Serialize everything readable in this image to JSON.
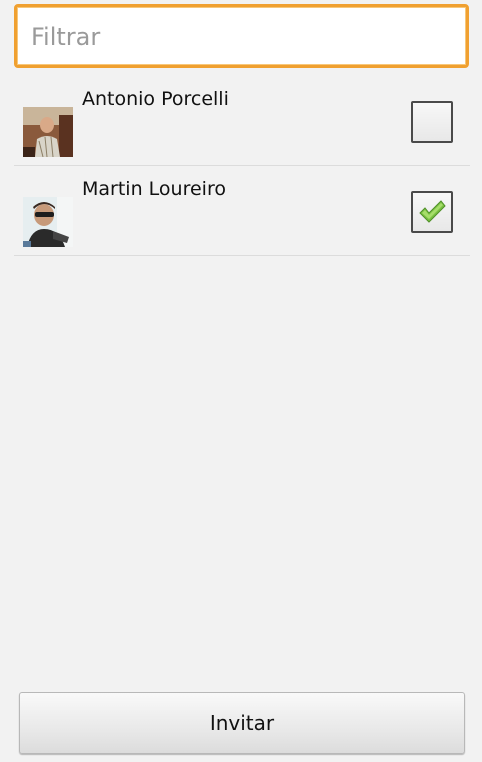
{
  "filter": {
    "placeholder": "Filtrar",
    "value": ""
  },
  "contacts": [
    {
      "name": "Antonio Porcelli",
      "checked": false
    },
    {
      "name": "Martin Loureiro",
      "checked": true
    }
  ],
  "invite_button": {
    "label": "Invitar"
  },
  "colors": {
    "focus_border": "#f0a030",
    "check_mark": "#7ac142",
    "background": "#f2f2f2"
  },
  "icons": {
    "checked": "check-icon"
  }
}
